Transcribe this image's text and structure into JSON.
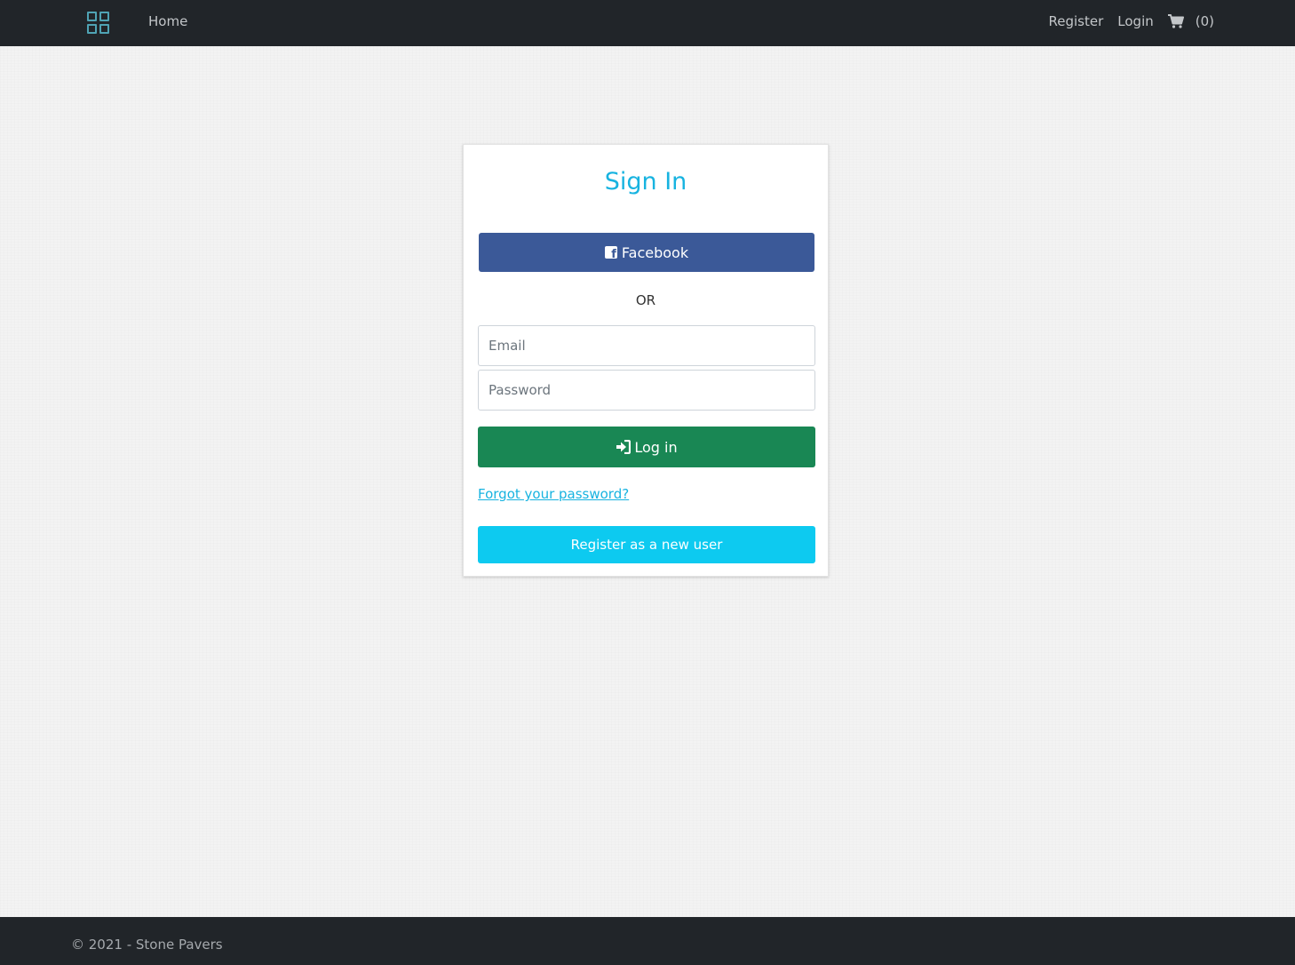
{
  "navbar": {
    "logo_icon": "grid-icon",
    "home_label": "Home",
    "register_label": "Register",
    "login_label": "Login",
    "cart_icon": "cart-icon",
    "cart_count": "(0)"
  },
  "signin": {
    "title": "Sign In",
    "facebook_label": "Facebook",
    "facebook_icon": "facebook-square-icon",
    "or_label": "OR",
    "email_placeholder": "Email",
    "password_placeholder": "Password",
    "login_label": "Log in",
    "login_icon": "sign-in-icon",
    "forgot_label": "Forgot your password?",
    "register_label": "Register as a new user"
  },
  "footer": {
    "text": "© 2021 - Stone Pavers"
  },
  "colors": {
    "navbar": "#212529",
    "title": "#17b3e0",
    "facebook": "#3b5998",
    "login": "#198754",
    "register": "#0dcaf0"
  }
}
